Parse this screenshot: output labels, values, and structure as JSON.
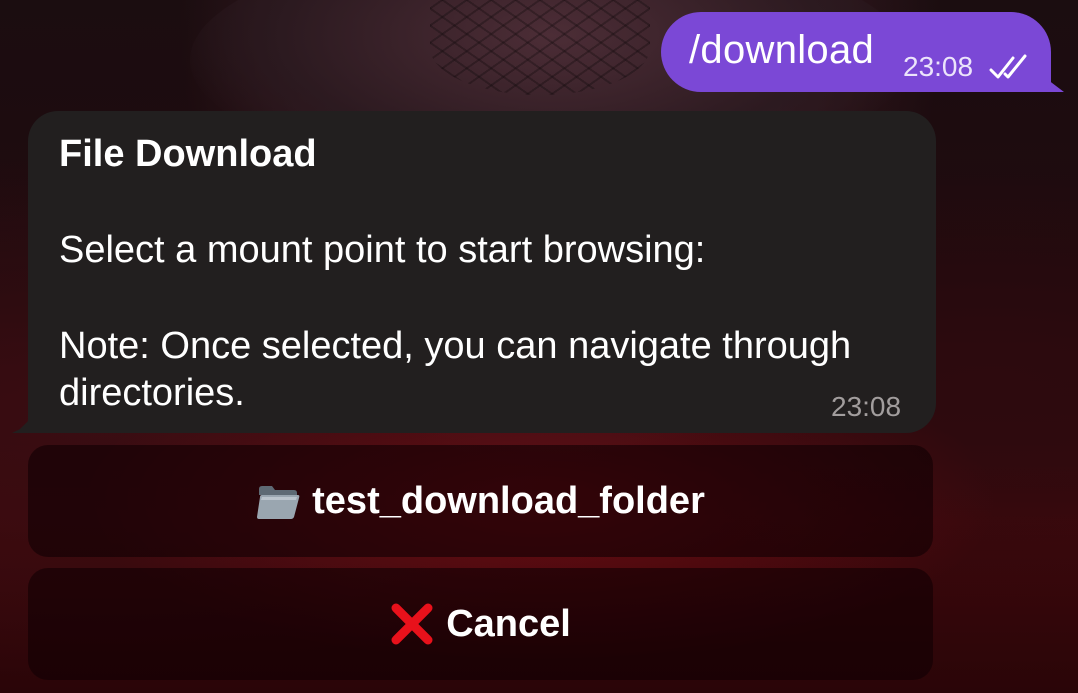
{
  "outgoing_message": {
    "text": "/download",
    "time": "23:08",
    "status_icon": "double-check-icon"
  },
  "incoming_message": {
    "title": "File Download",
    "line_1": "Select a mount point to start browsing:",
    "line_2": "Note: Once selected, you can navigate through",
    "line_3": "directories.",
    "time": "23:08"
  },
  "keyboard": {
    "folder_button": {
      "icon": "folder-icon",
      "label": "test_download_folder"
    },
    "cancel_button": {
      "icon": "cross-mark-icon",
      "label": "Cancel"
    }
  },
  "colors": {
    "outgoing_bubble": "#7b48d6",
    "incoming_bubble": "#221f1f",
    "cancel_cross": "#e8111b"
  }
}
